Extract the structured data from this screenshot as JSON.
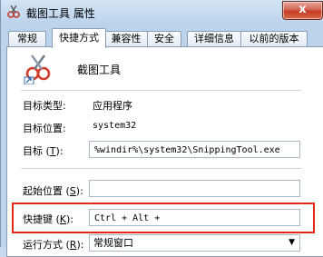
{
  "window": {
    "title": "截图工具 属性",
    "close_label": "x"
  },
  "tabs": [
    "常规",
    "快捷方式",
    "兼容性",
    "安全",
    "详细信息",
    "以前的版本"
  ],
  "app_name": "截图工具",
  "fields": {
    "target_type_label": "目标类型:",
    "target_type_value": "应用程序",
    "target_location_label": "目标位置:",
    "target_location_value": "system32",
    "target_label": "目标",
    "target_key": "T",
    "target_value": "%windir%\\system32\\SnippingTool.exe",
    "start_in_label": "起始位置",
    "start_in_key": "S",
    "start_in_value": "",
    "shortcut_label": "快捷键",
    "shortcut_key": "K",
    "shortcut_value": "Ctrl + Alt +",
    "run_label": "运行方式",
    "run_key": "R",
    "run_value": "常规窗口"
  },
  "colors": {
    "highlight": "#e3261a",
    "close": "#c33b23"
  }
}
